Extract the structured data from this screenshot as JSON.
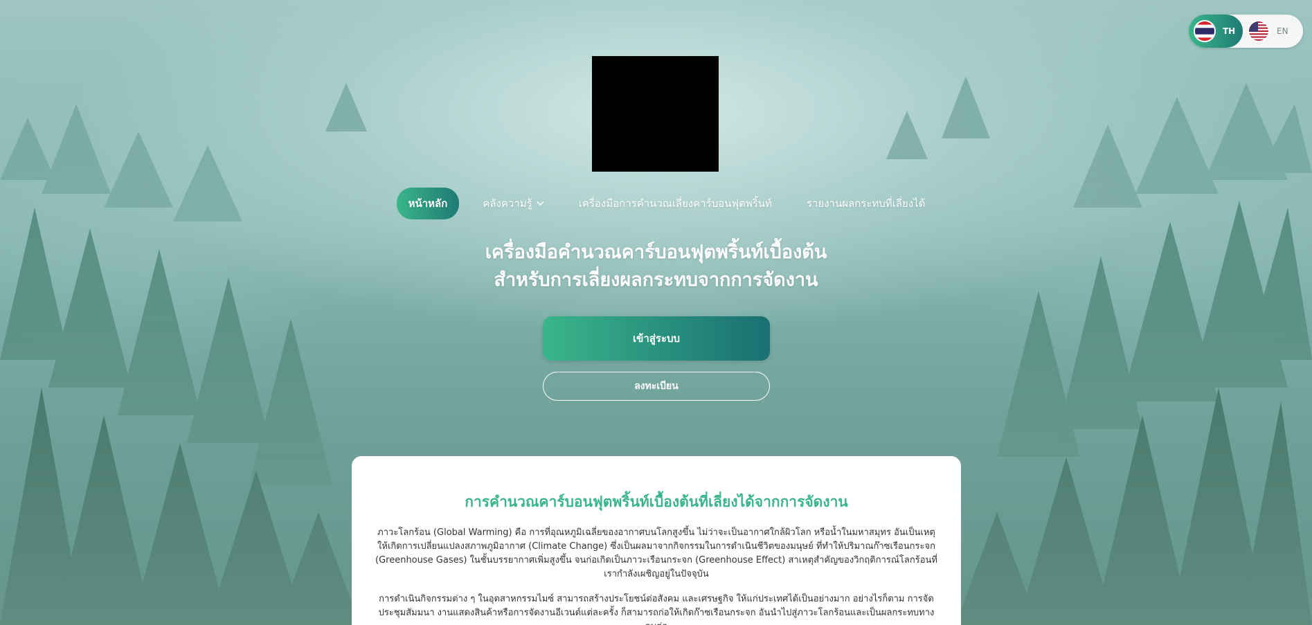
{
  "language_switch": {
    "options": [
      {
        "code": "TH",
        "flag": "thailand-flag",
        "active": true
      },
      {
        "code": "EN",
        "flag": "usa-flag",
        "active": false
      }
    ]
  },
  "nav": {
    "items": [
      {
        "label": "หน้าหลัก",
        "active": true
      },
      {
        "label": "คลังความรู้",
        "has_dropdown": true
      },
      {
        "label": "เครื่องมือการคำนวณเลี่ยงคาร์บอนฟุตพริ้นท์"
      },
      {
        "label": "รายงานผลกระทบที่เลี่ยงได้"
      }
    ]
  },
  "hero": {
    "title_line1": "เครื่องมือคำนวณคาร์บอนฟุตพริ้นท์เบื้องต้น",
    "title_line2": "สำหรับการเลี่ยงผลกระทบจากการจัดงาน",
    "login_label": "เข้าสู่ระบบ",
    "register_label": "ลงทะเบียน"
  },
  "card": {
    "title": "การคำนวณคาร์บอนฟุตพริ้นท์เบื้องต้นที่เลี่ยงได้จากการจัดงาน",
    "paragraph1": "ภาวะโลกร้อน (Global Warming) คือ การที่อุณหภูมิเฉลี่ยของอากาศบนโลกสูงขึ้น ไม่ว่าจะเป็นอากาศใกล้ผิวโลก หรือน้ำในมหาสมุทร อันเป็นเหตุให้เกิดการเปลี่ยนแปลงสภาพภูมิอากาศ (Climate Change) ซึ่งเป็นผลมาจากกิจกรรมในการดำเนินชีวิตของมนุษย์ ที่ทำให้ปริมาณก๊าซเรือนกระจก (Greenhouse Gases) ในชั้นบรรยากาศเพิ่มสูงขึ้น จนก่อเกิดเป็นภาวะเรือนกระจก (Greenhouse Effect) สาเหตุสำคัญของวิกฤติการณ์โลกร้อนที่เรากำลังเผชิญอยู่ในปัจจุบัน",
    "paragraph2": "การดำเนินกิจกรรมต่าง ๆ ในอุตสาหกรรมไมซ์ สามารถสร้างประโยชน์ต่อสังคม และเศรษฐกิจ ให้แก่ประเทศได้เป็นอย่างมาก อย่างไรก็ตาม การจัดประชุมสัมมนา งานแสดงสินค้าหรือการจัดงานอีเวนต์แต่ละครั้ง ก็สามารถก่อให้เกิดก๊าซเรือนกระจก อันนำไปสู่ภาวะโลกร้อนและเป็นผลกระทบทางลบต่อ"
  }
}
